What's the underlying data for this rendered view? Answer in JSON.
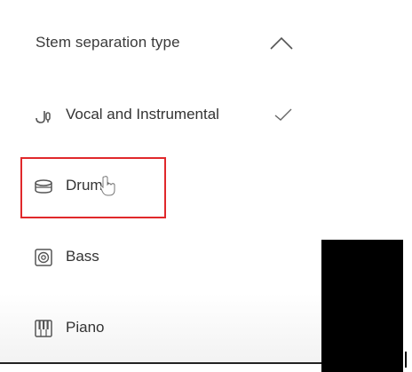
{
  "dropdown": {
    "header_label": "Stem separation type",
    "header_icon": "chevron-up-icon",
    "selected": "Vocal and Instrumental",
    "options": [
      {
        "label": "Vocal and Instrumental",
        "icon": "microphone-music-icon",
        "selected": true
      },
      {
        "label": "Drums",
        "icon": "drum-icon",
        "selected": false
      },
      {
        "label": "Bass",
        "icon": "speaker-icon",
        "selected": false
      },
      {
        "label": "Piano",
        "icon": "piano-icon",
        "selected": false
      }
    ]
  },
  "colors": {
    "highlight_border": "#e0282b",
    "text": "#333333",
    "icon": "#555555"
  }
}
